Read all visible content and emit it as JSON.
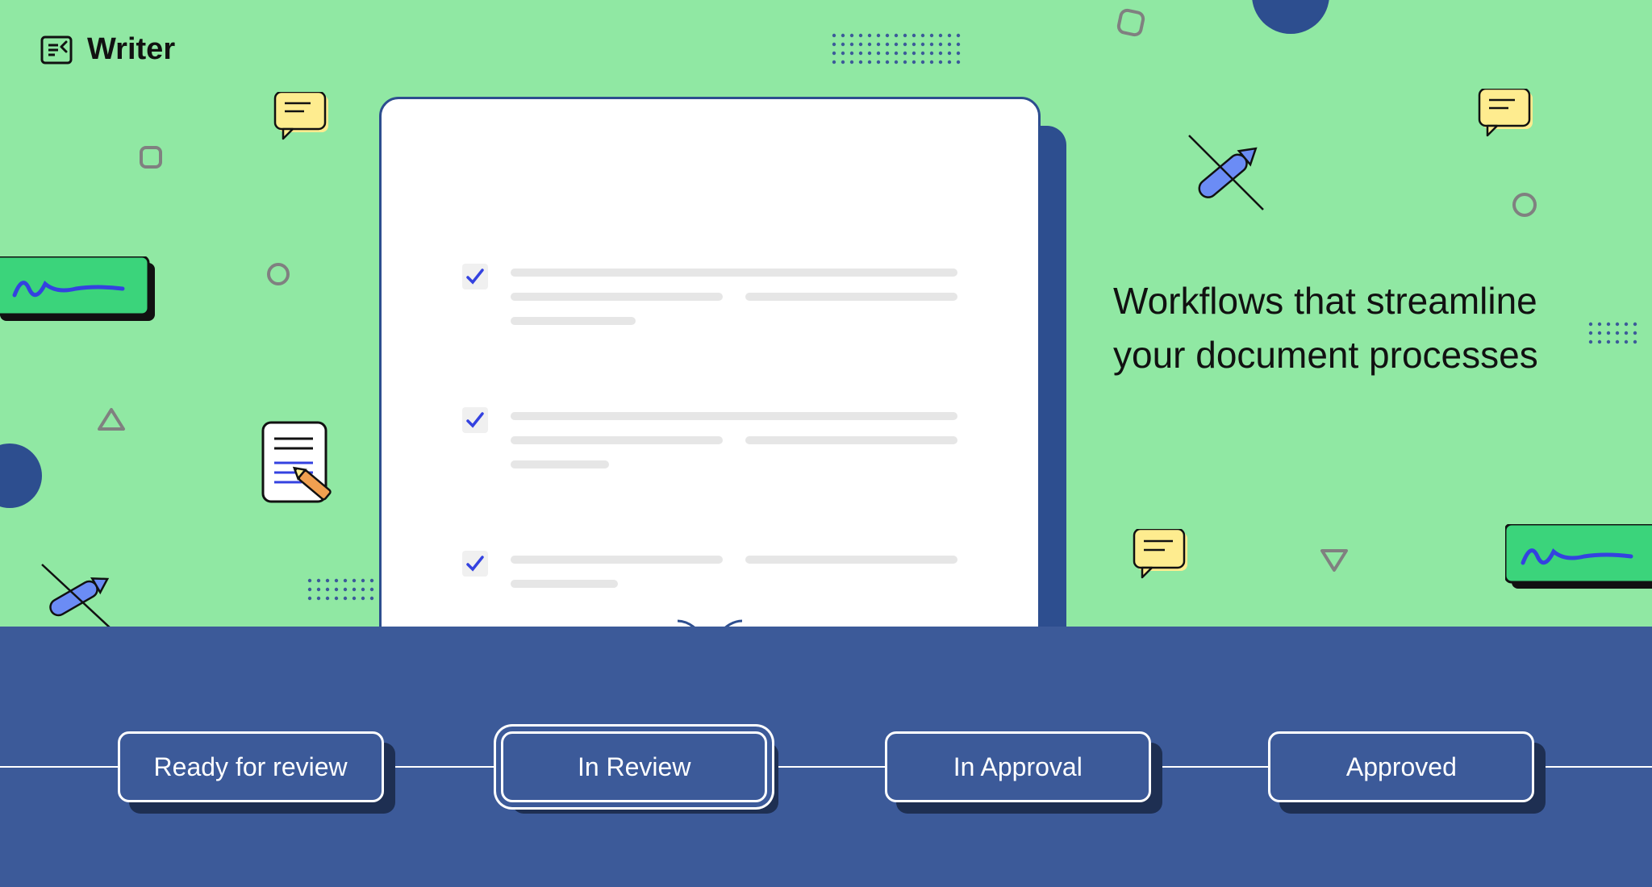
{
  "logo": {
    "text": "Writer"
  },
  "headline": "Workflows that streamline your document processes",
  "workflow": {
    "steps": [
      {
        "label": "Ready for review",
        "active": false
      },
      {
        "label": "In Review",
        "active": true
      },
      {
        "label": "In Approval",
        "active": false
      },
      {
        "label": "Approved",
        "active": false
      }
    ]
  },
  "colors": {
    "bg_green": "#90e8a3",
    "blue_dark": "#2d4e8f",
    "blue_bar": "#3c5a99",
    "yellow": "#feec8f",
    "signature_green": "#3bd47b",
    "gray": "#808080",
    "pencil_blue": "#4b6ef5",
    "pencil_orange": "#f0a050"
  }
}
